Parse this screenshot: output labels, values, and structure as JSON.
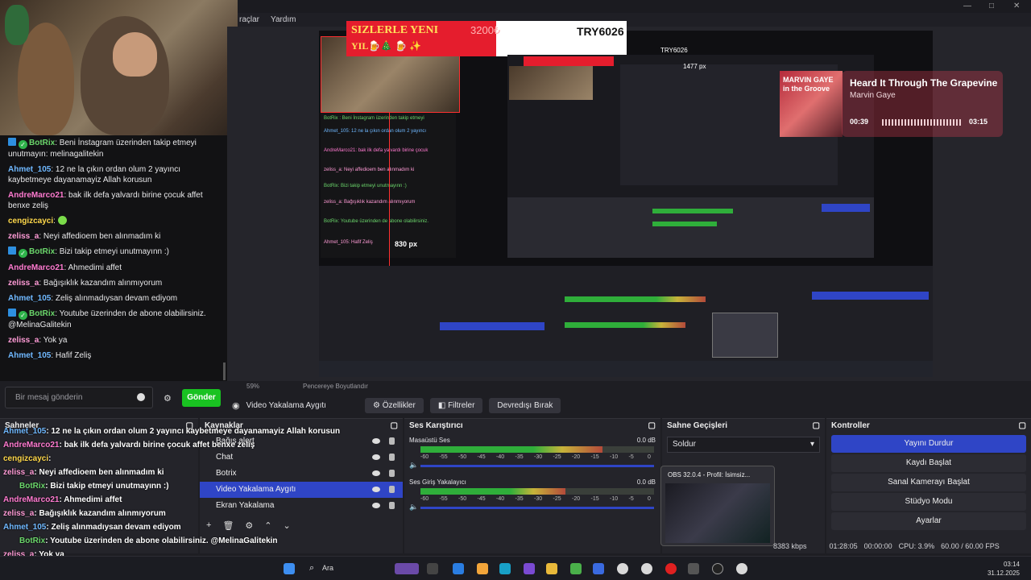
{
  "menu": {
    "items": [
      "raçlar",
      "Yardım"
    ]
  },
  "window_controls": [
    "—",
    "□",
    "✕"
  ],
  "chat": {
    "messages": [
      {
        "user": "BotRix",
        "text": ": Beni İnstagram üzerinden takip etmeyi unutmayın: melinagalitekin",
        "badge": true
      },
      {
        "user": "Ahmet_105",
        "text": ": 12 ne la çıkın ordan olum 2 yayıncı kaybetmeye dayanamayiz Allah korusun",
        "badge": false
      },
      {
        "user": "AndreMarco21",
        "text": ": bak ilk defa yalvardı birine çocuk affet benxe zeliş",
        "badge": false
      },
      {
        "user": "cengizcayci",
        "text": ":",
        "badge": false
      },
      {
        "user": "zeliss_a",
        "text": ": Neyi affedioem ben alınmadım ki",
        "badge": false
      },
      {
        "user": "BotRix",
        "text": ": Bizi takip etmeyi unutmayınn :)",
        "badge": true
      },
      {
        "user": "AndreMarco21",
        "text": ": Ahmedimi affet",
        "badge": false
      },
      {
        "user": "zeliss_a",
        "text": ": Bağışıklık kazandım alınmıyorum",
        "badge": false
      },
      {
        "user": "Ahmet_105",
        "text": ": Zeliş alınmadıysan devam ediyom",
        "badge": false
      },
      {
        "user": "BotRix",
        "text": ": Youtube üzerinden de abone olabilirsiniz. @MelinaGalitekin",
        "badge": true
      },
      {
        "user": "zeliss_a",
        "text": ": Yok ya",
        "badge": false
      },
      {
        "user": "Ahmet_105",
        "text": ": Hafif Zeliş",
        "badge": false
      }
    ],
    "input_placeholder": "Bir mesaj gönderin",
    "send_label": "Gönder"
  },
  "ticker": {
    "headline": "SIZLERLE YENI",
    "line2": "YIL🍺🎄 🍺 ✨",
    "amount": "3200₺",
    "code": "TRY6026"
  },
  "nested": {
    "code": "TRY6026",
    "px_label_1": "830 px",
    "px_label_2": "1477 px"
  },
  "music": {
    "title": "Heard It Through The Grapevine",
    "artist": "Marvin Gaye",
    "elapsed": "00:39",
    "total": "03:15",
    "album_text": "MARVIN GAYE in the Groove"
  },
  "zoom": {
    "percent": "59%",
    "mode": "Pencereye Boyutlandır"
  },
  "context_bar": {
    "source": "Video Yakalama Aygıtı",
    "props": "Özellikler",
    "filters": "Filtreler",
    "deactivate": "Devredışı Bırak"
  },
  "docks": {
    "scenes": {
      "title": "Sahneler"
    },
    "sources": {
      "title": "Kaynaklar",
      "items": [
        {
          "label": "Bağış alert",
          "selected": false
        },
        {
          "label": "Chat",
          "selected": false
        },
        {
          "label": "Botrix",
          "selected": false
        },
        {
          "label": "Video Yakalama Aygıtı",
          "selected": true
        },
        {
          "label": "Ekran Yakalama",
          "selected": false
        }
      ]
    },
    "mixer": {
      "title": "Ses Karıştırıcı",
      "channels": [
        {
          "name": "Masaüstü Ses",
          "db": "0.0 dB",
          "level": 0.78
        },
        {
          "name": "Ses Giriş Yakalayıcı",
          "db": "0.0 dB",
          "level": 0.62
        }
      ],
      "ticks": [
        "-60",
        "-55",
        "-50",
        "-45",
        "-40",
        "-35",
        "-30",
        "-25",
        "-20",
        "-15",
        "-10",
        "-5",
        "0"
      ]
    },
    "transitions": {
      "title": "Sahne Geçişleri",
      "value": "Soldur"
    },
    "controls": {
      "title": "Kontroller",
      "buttons": [
        "Yayını Durdur",
        "Kaydı Başlat",
        "Sanal Kamerayı Başlat",
        "Stüdyo Modu",
        "Ayarlar"
      ]
    }
  },
  "popup": {
    "title": "OBS 32.0.4 - Profil: İsimsiz..."
  },
  "status": {
    "kbps": "8383 kbps",
    "live_time": "01:28:05",
    "rec_time": "00:00:00",
    "cpu": "CPU: 3.9%",
    "fps": "60.00 / 60.00 FPS"
  },
  "overlay_chat": [
    {
      "user": "Ahmet_105",
      "text": ": 12 ne la çıkın ordan olum 2 yayıncı kaybetmeye dayanamayiz Allah korusun"
    },
    {
      "user": "AndreMarco21",
      "text": ": bak ilk defa yalvardı birine çocuk affet benxe zeliş"
    },
    {
      "user": "cengizcayci",
      "text": ":"
    },
    {
      "user": "zeliss_a",
      "text": ": Neyi affedioem ben alınmadım ki"
    },
    {
      "user": "BotRix",
      "text": ": Bizi takip etmeyi unutmayınn :)"
    },
    {
      "user": "AndreMarco21",
      "text": ": Ahmedimi affet"
    },
    {
      "user": "zeliss_a",
      "text": ": Bağışıklık kazandım alınmıyorum"
    },
    {
      "user": "Ahmet_105",
      "text": ": Zeliş alınmadıysan devam ediyom"
    },
    {
      "user": "BotRix",
      "text": ": Youtube üzerinden de abone olabilirsiniz. @MelinaGalitekin"
    },
    {
      "user": "zeliss_a",
      "text": ": Yok ya"
    },
    {
      "user": "Ahmet_105",
      "text": ": Hafif Zeliş"
    }
  ],
  "taskbar": {
    "search": "Ara",
    "time": "03:14",
    "date": "31.12.2025"
  },
  "colors": {
    "accent_blue": "#2f45c6",
    "send_green": "#19c221",
    "botrix_green": "#2fb34b",
    "ticker_red": "#e51d2d"
  }
}
